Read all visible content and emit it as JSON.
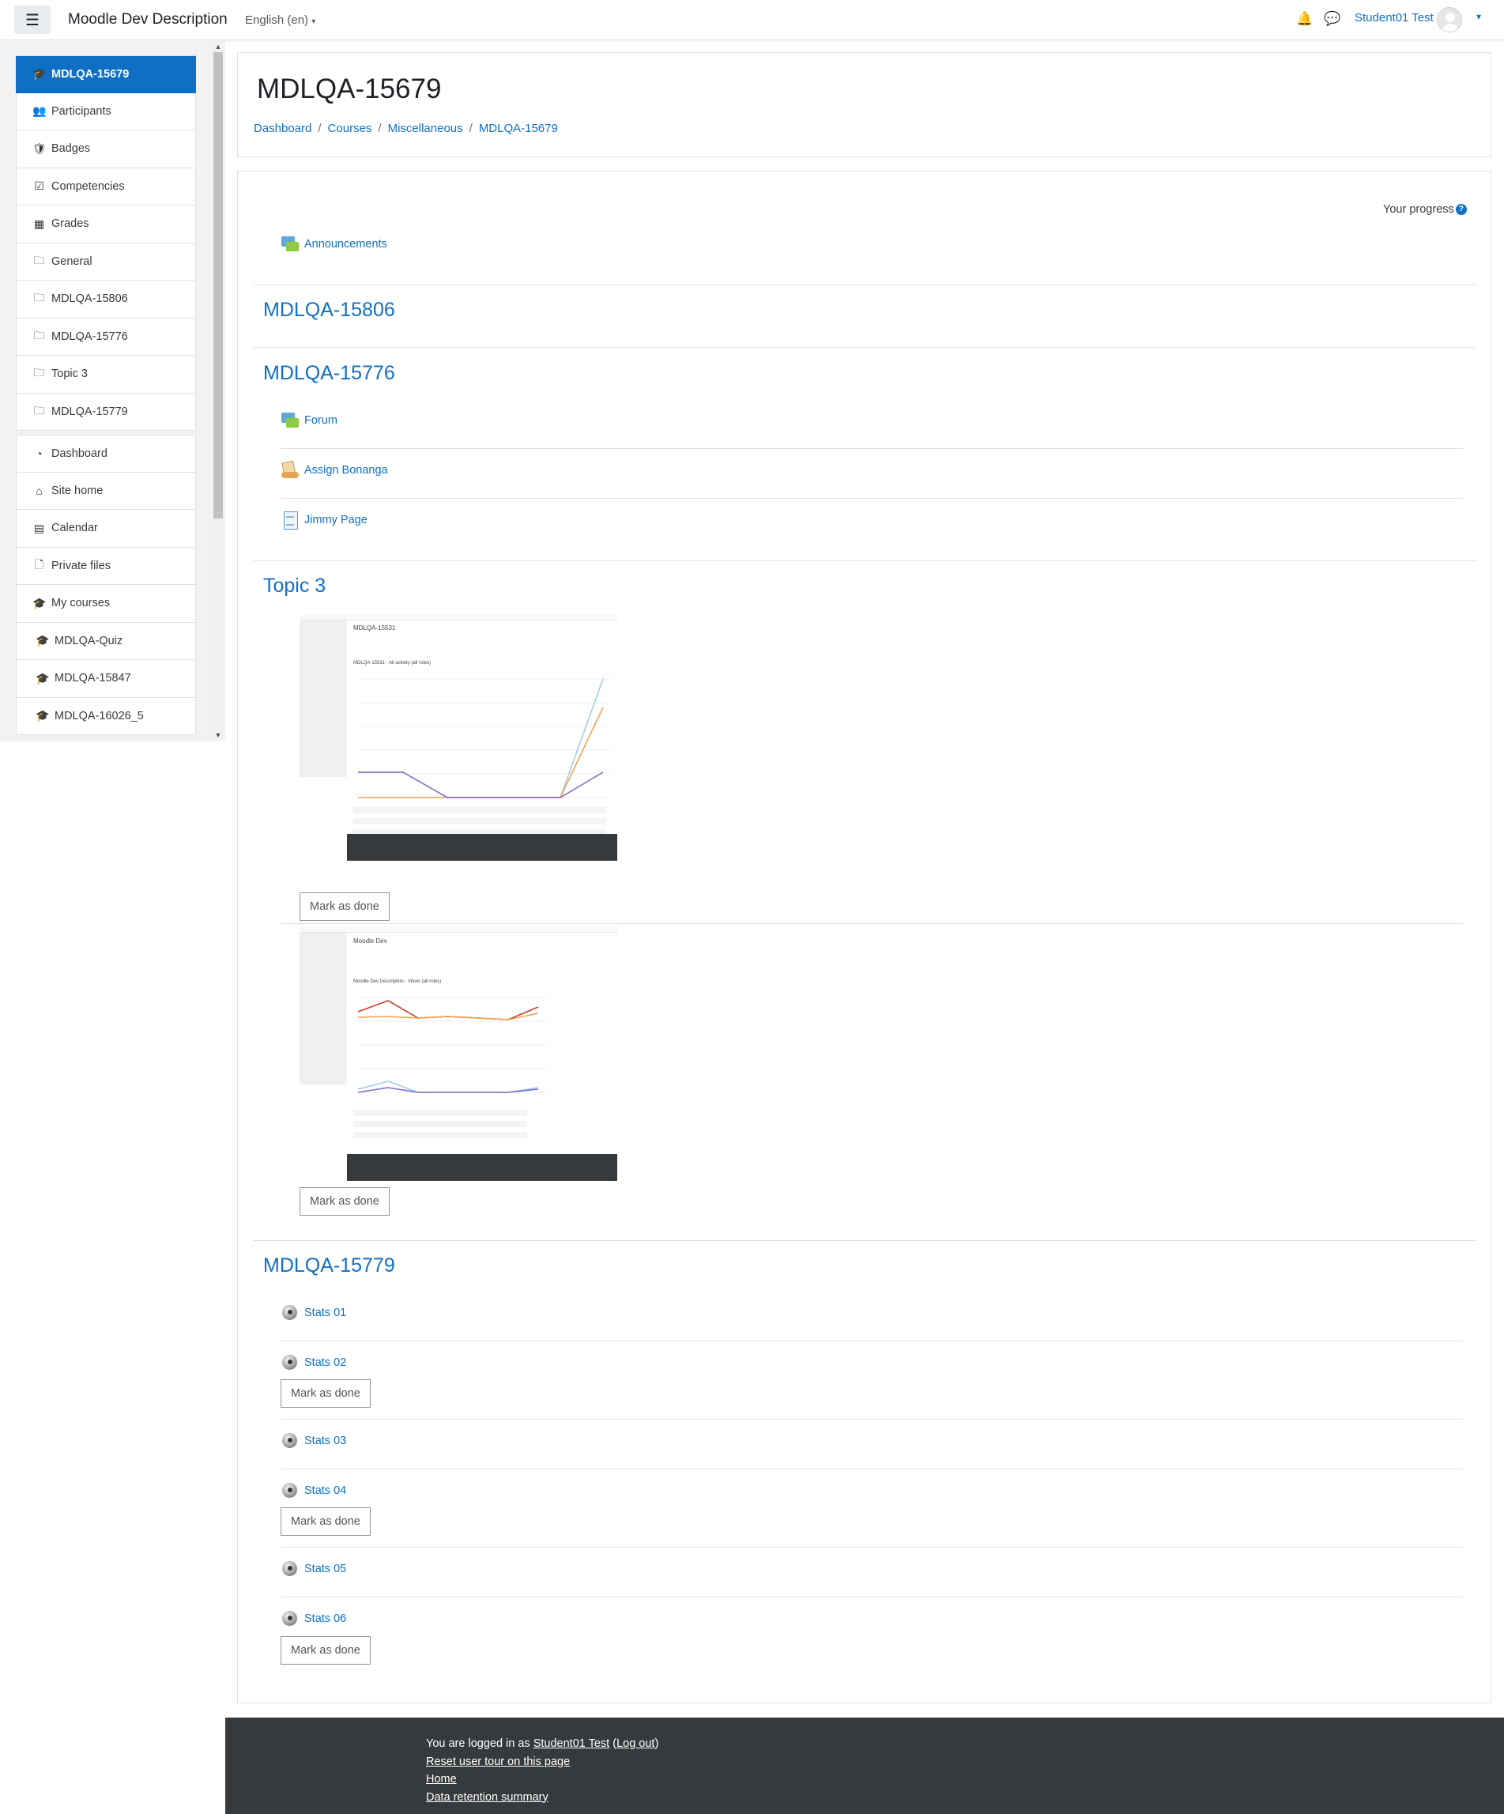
{
  "navbar": {
    "site_name": "Moodle Dev Description",
    "language": "English (en)",
    "user_name": "Student01 Test"
  },
  "drawer": {
    "course_items": [
      {
        "label": "MDLQA-15679",
        "icon": "graduation-cap-icon"
      },
      {
        "label": "Participants",
        "icon": "users-icon"
      },
      {
        "label": "Badges",
        "icon": "shield-icon"
      },
      {
        "label": "Competencies",
        "icon": "check-square-icon"
      },
      {
        "label": "Grades",
        "icon": "table-icon"
      },
      {
        "label": "General",
        "icon": "folder-icon"
      },
      {
        "label": "MDLQA-15806",
        "icon": "folder-icon"
      },
      {
        "label": "MDLQA-15776",
        "icon": "folder-icon"
      },
      {
        "label": "Topic 3",
        "icon": "folder-icon"
      },
      {
        "label": "MDLQA-15779",
        "icon": "folder-icon"
      }
    ],
    "site_items": [
      {
        "label": "Dashboard",
        "icon": "dashboard-icon"
      },
      {
        "label": "Site home",
        "icon": "home-icon"
      },
      {
        "label": "Calendar",
        "icon": "calendar-icon"
      },
      {
        "label": "Private files",
        "icon": "file-icon"
      },
      {
        "label": "My courses",
        "icon": "graduation-cap-icon"
      },
      {
        "label": "MDLQA-Quiz",
        "icon": "graduation-cap-icon"
      },
      {
        "label": "MDLQA-15847",
        "icon": "graduation-cap-icon"
      },
      {
        "label": "MDLQA-16026_5",
        "icon": "graduation-cap-icon"
      }
    ]
  },
  "header": {
    "title": "MDLQA-15679",
    "breadcrumb": [
      "Dashboard",
      "Courses",
      "Miscellaneous",
      "MDLQA-15679"
    ]
  },
  "course": {
    "progress_label": "Your progress",
    "general_activity": "Announcements",
    "sections": [
      {
        "title": "MDLQA-15806"
      },
      {
        "title": "MDLQA-15776",
        "activities": [
          "Forum",
          "Assign Bonanga",
          "Jimmy Page"
        ]
      },
      {
        "title": "Topic 3"
      },
      {
        "title": "MDLQA-15779",
        "activities": [
          "Stats 01",
          "Stats 02",
          "Stats 03",
          "Stats 04",
          "Stats 05",
          "Stats 06"
        ]
      }
    ],
    "mark_done_label": "Mark as done",
    "thumb1": {
      "title": "MDLQA-15531",
      "subtitle": "MDLQA-15531 - All activity (all roles)"
    },
    "thumb2": {
      "title": "Moodle Dev",
      "subtitle": "Moodle Dev Description - Views (all roles)"
    }
  },
  "footer": {
    "logged_in_prefix": "You are logged in as ",
    "logged_in_user": "Student01 Test",
    "logout_label": "Log out",
    "reset_tour": "Reset user tour on this page",
    "home": "Home",
    "data_retention": "Data retention summary"
  },
  "colors": {
    "accent": "#0f6fc5",
    "footer_bg": "#373a3c",
    "series_purple": "#8566c2",
    "series_orange": "#f0a04b",
    "series_lightblue": "#9ccaf0",
    "series_red": "#c0392b"
  }
}
